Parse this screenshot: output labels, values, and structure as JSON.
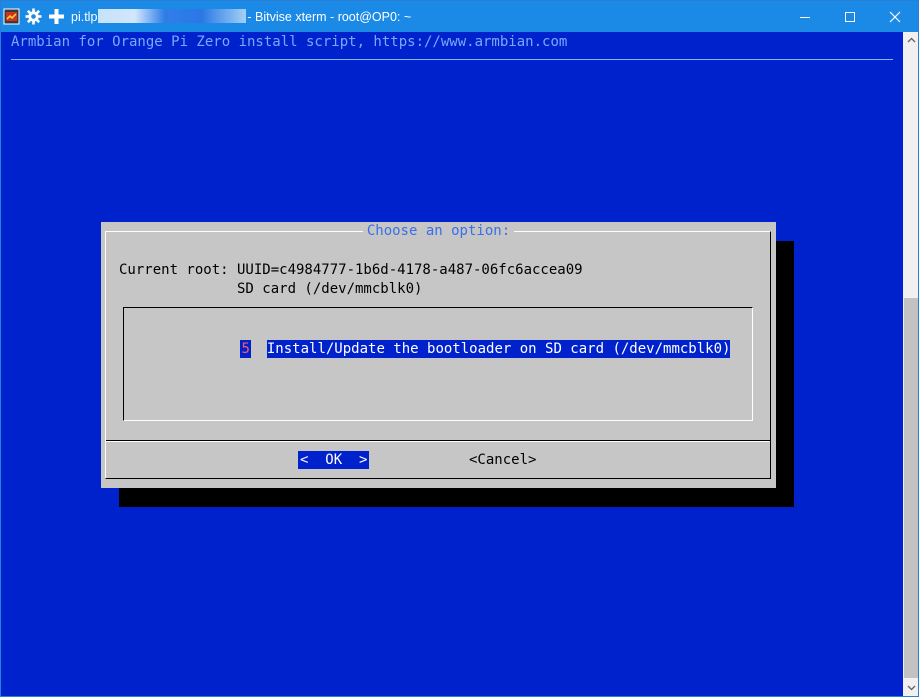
{
  "titlebar": {
    "host": "pi.tlp",
    "title_suffix": "- Bitvise xterm - root@OP0: ~",
    "icons": [
      "terminal-app-icon",
      "gear-icon",
      "plus-icon"
    ],
    "controls": [
      "minimize-icon",
      "maximize-icon",
      "close-icon"
    ]
  },
  "terminal": {
    "header": "Armbian for Orange Pi Zero install script, https://www.armbian.com",
    "bg_color": "#0022cc"
  },
  "dialog": {
    "title": "Choose an option:",
    "line1": "Current root: UUID=c4984777-1b6d-4178-a487-06fc6accea09",
    "line2": "              SD card (/dev/mmcblk0)",
    "menu_items": [
      {
        "tag": "5",
        "label": "Install/Update the bootloader on SD card (/dev/mmcblk0)"
      }
    ],
    "ok_label": "<  OK  >",
    "cancel_label": "<Cancel>"
  }
}
